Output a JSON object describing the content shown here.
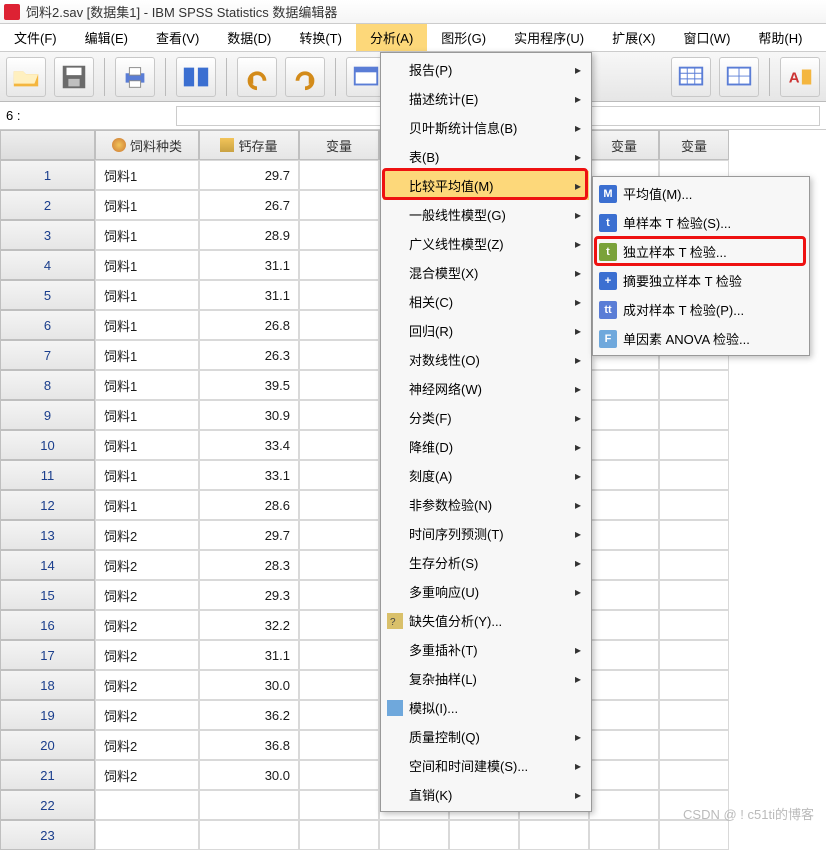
{
  "title": "饲料2.sav [数据集1] - IBM SPSS Statistics 数据编辑器",
  "menubar": {
    "file": "文件(F)",
    "edit": "编辑(E)",
    "view": "查看(V)",
    "data": "数据(D)",
    "transform": "转换(T)",
    "analyze": "分析(A)",
    "graph": "图形(G)",
    "utilities": "实用程序(U)",
    "extensions": "扩展(X)",
    "window": "窗口(W)",
    "help": "帮助(H)"
  },
  "address": {
    "row_label": "6 :",
    "value": ""
  },
  "columns": {
    "c1": "饲料种类",
    "c2": "钙存量",
    "var": "变量"
  },
  "rows": [
    {
      "n": "1",
      "type": "饲料1",
      "val": "29.7"
    },
    {
      "n": "2",
      "type": "饲料1",
      "val": "26.7"
    },
    {
      "n": "3",
      "type": "饲料1",
      "val": "28.9"
    },
    {
      "n": "4",
      "type": "饲料1",
      "val": "31.1"
    },
    {
      "n": "5",
      "type": "饲料1",
      "val": "31.1"
    },
    {
      "n": "6",
      "type": "饲料1",
      "val": "26.8"
    },
    {
      "n": "7",
      "type": "饲料1",
      "val": "26.3"
    },
    {
      "n": "8",
      "type": "饲料1",
      "val": "39.5"
    },
    {
      "n": "9",
      "type": "饲料1",
      "val": "30.9"
    },
    {
      "n": "10",
      "type": "饲料1",
      "val": "33.4"
    },
    {
      "n": "11",
      "type": "饲料1",
      "val": "33.1"
    },
    {
      "n": "12",
      "type": "饲料1",
      "val": "28.6"
    },
    {
      "n": "13",
      "type": "饲料2",
      "val": "29.7"
    },
    {
      "n": "14",
      "type": "饲料2",
      "val": "28.3"
    },
    {
      "n": "15",
      "type": "饲料2",
      "val": "29.3"
    },
    {
      "n": "16",
      "type": "饲料2",
      "val": "32.2"
    },
    {
      "n": "17",
      "type": "饲料2",
      "val": "31.1"
    },
    {
      "n": "18",
      "type": "饲料2",
      "val": "30.0"
    },
    {
      "n": "19",
      "type": "饲料2",
      "val": "36.2"
    },
    {
      "n": "20",
      "type": "饲料2",
      "val": "36.8"
    },
    {
      "n": "21",
      "type": "饲料2",
      "val": "30.0"
    },
    {
      "n": "22",
      "type": "",
      "val": ""
    },
    {
      "n": "23",
      "type": "",
      "val": ""
    }
  ],
  "analyze_menu": {
    "report": "报告(P)",
    "descriptive": "描述统计(E)",
    "bayes": "贝叶斯统计信息(B)",
    "tables": "表(B)",
    "compare_means": "比较平均值(M)",
    "glm": "一般线性模型(G)",
    "gzlm": "广义线性模型(Z)",
    "mixed": "混合模型(X)",
    "correlate": "相关(C)",
    "regression": "回归(R)",
    "loglinear": "对数线性(O)",
    "neural": "神经网络(W)",
    "classify": "分类(F)",
    "dimred": "降维(D)",
    "scale": "刻度(A)",
    "nonpar": "非参数检验(N)",
    "forecast": "时间序列预测(T)",
    "survival": "生存分析(S)",
    "multresp": "多重响应(U)",
    "missing": "缺失值分析(Y)...",
    "mi": "多重插补(T)",
    "complex": "复杂抽样(L)",
    "sim": "模拟(I)...",
    "quality": "质量控制(Q)",
    "spatio": "空间和时间建模(S)...",
    "direct": "直销(K)"
  },
  "compare_means_sub": {
    "means": "平均值(M)...",
    "one_t": "单样本 T 检验(S)...",
    "ind_t": "独立样本 T 检验...",
    "sum_t": "摘要独立样本 T 检验",
    "paired_t": "成对样本 T 检验(P)...",
    "anova": "单因素 ANOVA 检验..."
  },
  "watermark": "CSDN @ ! c51ti的博客"
}
